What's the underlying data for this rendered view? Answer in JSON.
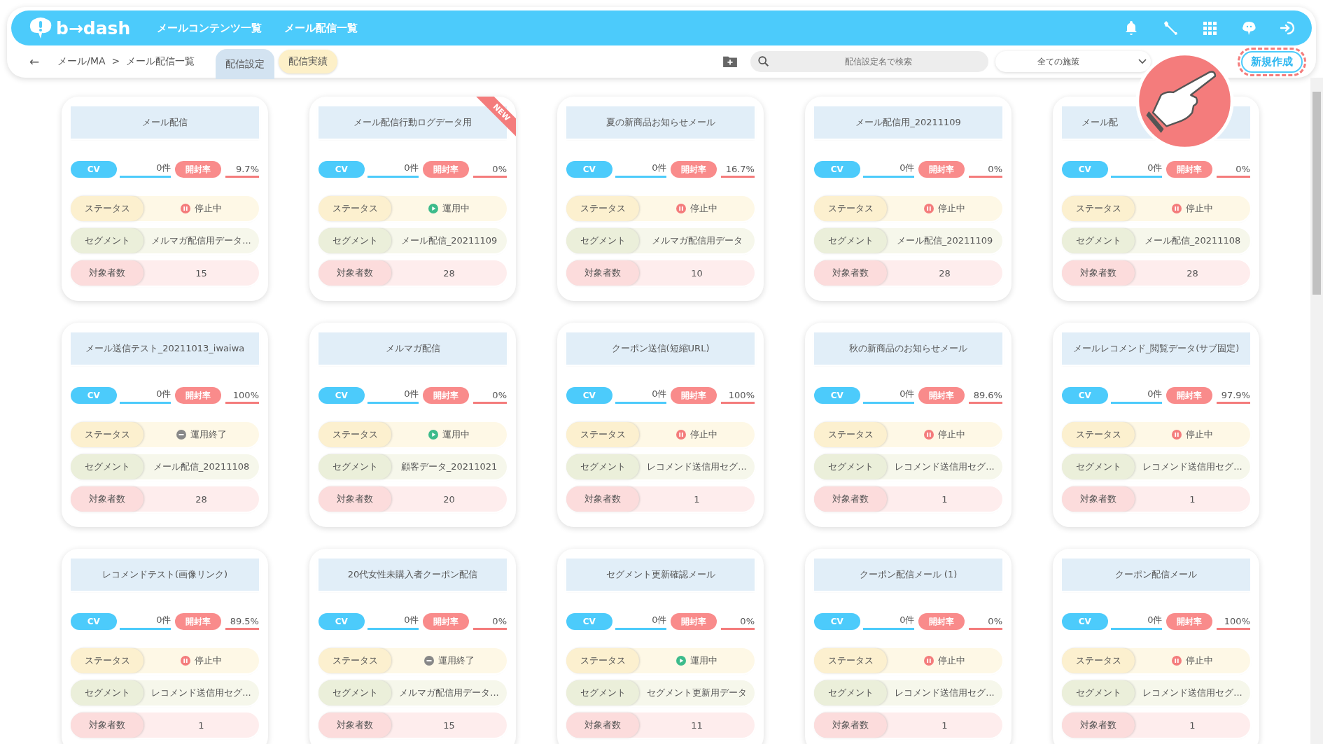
{
  "header": {
    "logo": "b→dash",
    "nav": [
      "メールコンテンツ一覧",
      "メール配信一覧"
    ]
  },
  "subbar": {
    "back": "←",
    "breadcrumb": "メール/MA  >  メール配信一覧",
    "tabs": [
      {
        "label": "配信設定",
        "selected": true
      },
      {
        "label": "配信実績",
        "selected": false
      }
    ],
    "search": {
      "placeholder": "配信設定名で検索"
    },
    "filter": {
      "value": "全ての施策"
    },
    "create_button": "新規作成"
  },
  "cards": [
    {
      "title": "メール配信",
      "new": false,
      "cut": false,
      "cv_label": "CV",
      "cv": "0件",
      "open_label": "開封率",
      "open_rate": "9.7%",
      "status_label": "ステータス",
      "status": {
        "kind": "stopped",
        "label": "停止中"
      },
      "segment_label": "セグメント",
      "segment": "メルマガ配信用データ...",
      "count_label": "対象者数",
      "count": "15"
    },
    {
      "title": "メール配信行動ログデータ用",
      "new": true,
      "new_label": "NEW",
      "cut": false,
      "cv_label": "CV",
      "cv": "0件",
      "open_label": "開封率",
      "open_rate": "0%",
      "status_label": "ステータス",
      "status": {
        "kind": "running",
        "label": "運用中"
      },
      "segment_label": "セグメント",
      "segment": "メール配信_20211109",
      "count_label": "対象者数",
      "count": "28"
    },
    {
      "title": "夏の新商品お知らせメール",
      "new": false,
      "cut": false,
      "cv_label": "CV",
      "cv": "0件",
      "open_label": "開封率",
      "open_rate": "16.7%",
      "status_label": "ステータス",
      "status": {
        "kind": "stopped",
        "label": "停止中"
      },
      "segment_label": "セグメント",
      "segment": "メルマガ配信用データ",
      "count_label": "対象者数",
      "count": "10"
    },
    {
      "title": "メール配信用_20211109",
      "new": false,
      "cut": false,
      "cv_label": "CV",
      "cv": "0件",
      "open_label": "開封率",
      "open_rate": "0%",
      "status_label": "ステータス",
      "status": {
        "kind": "stopped",
        "label": "停止中"
      },
      "segment_label": "セグメント",
      "segment": "メール配信_20211109",
      "count_label": "対象者数",
      "count": "28"
    },
    {
      "title": "メール配",
      "new": false,
      "cut": true,
      "cv_label": "CV",
      "cv": "0件",
      "open_label": "開封率",
      "open_rate": "0%",
      "status_label": "ステータス",
      "status": {
        "kind": "stopped",
        "label": "停止中"
      },
      "segment_label": "セグメント",
      "segment": "メール配信_20211108",
      "count_label": "対象者数",
      "count": "28"
    },
    {
      "title": "メール送信テスト_20211013_iwaiwa",
      "new": false,
      "cut": false,
      "cv_label": "CV",
      "cv": "0件",
      "open_label": "開封率",
      "open_rate": "100%",
      "status_label": "ステータス",
      "status": {
        "kind": "ended",
        "label": "運用終了"
      },
      "segment_label": "セグメント",
      "segment": "メール配信_20211108",
      "count_label": "対象者数",
      "count": "28"
    },
    {
      "title": "メルマガ配信",
      "new": false,
      "cut": false,
      "cv_label": "CV",
      "cv": "0件",
      "open_label": "開封率",
      "open_rate": "0%",
      "status_label": "ステータス",
      "status": {
        "kind": "running",
        "label": "運用中"
      },
      "segment_label": "セグメント",
      "segment": "顧客データ_20211021",
      "count_label": "対象者数",
      "count": "20"
    },
    {
      "title": "クーポン送信(短縮URL)",
      "new": false,
      "cut": false,
      "cv_label": "CV",
      "cv": "0件",
      "open_label": "開封率",
      "open_rate": "100%",
      "status_label": "ステータス",
      "status": {
        "kind": "stopped",
        "label": "停止中"
      },
      "segment_label": "セグメント",
      "segment": "レコメンド送信用セグ...",
      "count_label": "対象者数",
      "count": "1"
    },
    {
      "title": "秋の新商品のお知らせメール",
      "new": false,
      "cut": false,
      "cv_label": "CV",
      "cv": "0件",
      "open_label": "開封率",
      "open_rate": "89.6%",
      "status_label": "ステータス",
      "status": {
        "kind": "stopped",
        "label": "停止中"
      },
      "segment_label": "セグメント",
      "segment": "レコメンド送信用セグ...",
      "count_label": "対象者数",
      "count": "1"
    },
    {
      "title": "メールレコメンド_閲覧データ(サブ固定)",
      "new": false,
      "cut": false,
      "cv_label": "CV",
      "cv": "0件",
      "open_label": "開封率",
      "open_rate": "97.9%",
      "status_label": "ステータス",
      "status": {
        "kind": "stopped",
        "label": "停止中"
      },
      "segment_label": "セグメント",
      "segment": "レコメンド送信用セグ...",
      "count_label": "対象者数",
      "count": "1"
    },
    {
      "title": "レコメンドテスト(画像リンク)",
      "new": false,
      "cut": false,
      "cv_label": "CV",
      "cv": "0件",
      "open_label": "開封率",
      "open_rate": "89.5%",
      "status_label": "ステータス",
      "status": {
        "kind": "stopped",
        "label": "停止中"
      },
      "segment_label": "セグメント",
      "segment": "レコメンド送信用セグ...",
      "count_label": "対象者数",
      "count": "1"
    },
    {
      "title": "20代女性未購入者クーポン配信",
      "new": false,
      "cut": false,
      "cv_label": "CV",
      "cv": "0件",
      "open_label": "開封率",
      "open_rate": "0%",
      "status_label": "ステータス",
      "status": {
        "kind": "ended",
        "label": "運用終了"
      },
      "segment_label": "セグメント",
      "segment": "メルマガ配信用データ...",
      "count_label": "対象者数",
      "count": "15"
    },
    {
      "title": "セグメント更新確認メール",
      "new": false,
      "cut": false,
      "cv_label": "CV",
      "cv": "0件",
      "open_label": "開封率",
      "open_rate": "0%",
      "status_label": "ステータス",
      "status": {
        "kind": "running",
        "label": "運用中"
      },
      "segment_label": "セグメント",
      "segment": "セグメント更新用データ",
      "count_label": "対象者数",
      "count": "11"
    },
    {
      "title": "クーポン配信メール (1)",
      "new": false,
      "cut": false,
      "cv_label": "CV",
      "cv": "0件",
      "open_label": "開封率",
      "open_rate": "0%",
      "status_label": "ステータス",
      "status": {
        "kind": "stopped",
        "label": "停止中"
      },
      "segment_label": "セグメント",
      "segment": "レコメンド送信用セグ...",
      "count_label": "対象者数",
      "count": "1"
    },
    {
      "title": "クーポン配信メール",
      "new": false,
      "cut": false,
      "cv_label": "CV",
      "cv": "0件",
      "open_label": "開封率",
      "open_rate": "100%",
      "status_label": "ステータス",
      "status": {
        "kind": "stopped",
        "label": "停止中"
      },
      "segment_label": "セグメント",
      "segment": "レコメンド送信用セグ...",
      "count_label": "対象者数",
      "count": "1"
    }
  ]
}
